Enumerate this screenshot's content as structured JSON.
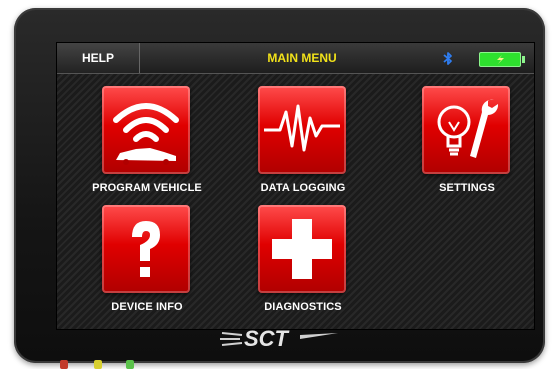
{
  "header": {
    "help_label": "HELP",
    "title": "MAIN MENU"
  },
  "status": {
    "bluetooth_icon": "bluetooth-icon",
    "battery_icon": "battery-charging-icon"
  },
  "menu": [
    {
      "label": "PROGRAM VEHICLE",
      "icon": "wireless-car-icon"
    },
    {
      "label": "DATA LOGGING",
      "icon": "waveform-icon"
    },
    {
      "label": "SETTINGS",
      "icon": "bulb-wrench-icon"
    },
    {
      "label": "DEVICE INFO",
      "icon": "question-mark-icon"
    },
    {
      "label": "DIAGNOSTICS",
      "icon": "cross-icon"
    }
  ],
  "brand": {
    "logo_text": "SCT"
  },
  "colors": {
    "title": "#f2e21a",
    "tile": "#e00000",
    "battery": "#2ee02e",
    "bluetooth": "#2f7df0"
  }
}
